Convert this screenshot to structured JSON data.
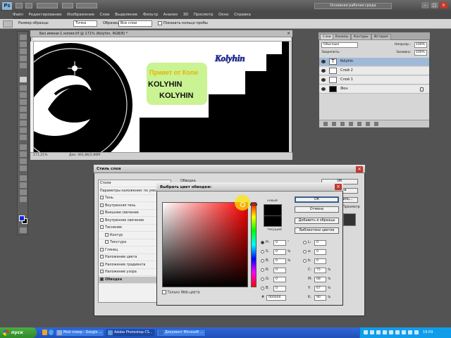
{
  "app": {
    "logo": "Ps",
    "workspace_button": "Основная рабочая среда",
    "menu": [
      "Файл",
      "Редактирование",
      "Изображение",
      "Слои",
      "Выделение",
      "Фильтр",
      "Анализ",
      "3D",
      "Просмотр",
      "Окно",
      "Справка"
    ],
    "window_controls": [
      "minimize-icon",
      "maximize-icon",
      "close-icon"
    ]
  },
  "options_bar": {
    "size_label": "Размер образца:",
    "size_value": "Точка",
    "sample_label": "Образец:",
    "sample_value": "Все слои",
    "show_ring_label": "Показать кольцо пробы"
  },
  "document": {
    "tab_title": "Без имени-1 копия.tif @ 171% (Kolyhin, RGB/8) *",
    "zoom": "171,21%",
    "info": "Док: 461,8K/2,86M",
    "canvas_text": {
      "green_line1": "Привет от Коли",
      "green_line2": "KOLYHIN",
      "green_line3": "KOLYHIN",
      "blue_logo": "Kolyhin"
    }
  },
  "layers_panel": {
    "tabs": [
      "Слои",
      "Каналы",
      "Контуры",
      "История"
    ],
    "blend_mode": "Обычные",
    "opacity_label": "Непрозр.:",
    "opacity_value": "100%",
    "fill_label": "Заливка:",
    "fill_value": "100%",
    "lock_label": "Закрепить:",
    "layers": [
      {
        "name": "Kolyhin",
        "type": "text",
        "selected": true
      },
      {
        "name": "Слой 2",
        "type": "pixel",
        "selected": false
      },
      {
        "name": "Слой 1",
        "type": "pixel",
        "selected": false
      },
      {
        "name": "Фон",
        "type": "background",
        "selected": false
      }
    ]
  },
  "layer_style_dialog": {
    "title": "Стиль слоя",
    "group_header": "Обводка",
    "items": [
      {
        "label": "Стили",
        "checkbox": false,
        "selected": false
      },
      {
        "label": "Параметры наложения: по умолчанию",
        "checkbox": false,
        "selected": false
      },
      {
        "label": "Тень",
        "checkbox": true,
        "selected": false
      },
      {
        "label": "Внутренняя тень",
        "checkbox": true,
        "selected": false
      },
      {
        "label": "Внешнее свечение",
        "checkbox": true,
        "selected": false
      },
      {
        "label": "Внутреннее свечение",
        "checkbox": true,
        "selected": false
      },
      {
        "label": "Тиснение",
        "checkbox": true,
        "selected": false
      },
      {
        "label": "Контур",
        "checkbox": true,
        "selected": false,
        "indent": true
      },
      {
        "label": "Текстура",
        "checkbox": true,
        "selected": false,
        "indent": true
      },
      {
        "label": "Глянец",
        "checkbox": true,
        "selected": false
      },
      {
        "label": "Наложение цвета",
        "checkbox": true,
        "selected": false
      },
      {
        "label": "Наложение градиента",
        "checkbox": true,
        "selected": false
      },
      {
        "label": "Наложение узора",
        "checkbox": true,
        "selected": false
      },
      {
        "label": "Обводка",
        "checkbox": true,
        "selected": true
      }
    ],
    "side_buttons": [
      "ОК",
      "Отмена",
      "Новый стиль..."
    ],
    "side_label": "Просмотр"
  },
  "color_picker": {
    "title": "Выбрать цвет обводки:",
    "new_label": "новый",
    "current_label": "текущий",
    "buttons": [
      "ОК",
      "Отмена",
      "Добавить в образцы",
      "Библиотеки цветов"
    ],
    "fields": {
      "H": "0",
      "S": "0",
      "B": "0",
      "R": "0",
      "G": "0",
      "Bl": "0",
      "L": "0",
      "a": "0",
      "b": "0",
      "C": "75",
      "M": "68",
      "Y": "67",
      "K": "90",
      "hex": "000000"
    },
    "units": {
      "degree": "°",
      "percent": "%"
    },
    "web_only_label": "Только Web-цвета",
    "sat_cursor_pct": {
      "saturation": 95,
      "brightness": 100
    },
    "hue_pct": 2
  },
  "taskbar": {
    "start_label": "пуск",
    "tasks": [
      {
        "label": "Мой плеер - Google ...",
        "active": false
      },
      {
        "label": "Adobe Photoshop CS...",
        "active": true
      },
      {
        "label": "Документ Microsoft ...",
        "active": false
      }
    ],
    "clock": "19:59"
  },
  "colors": {
    "foreground": "#0a2dd8",
    "background": "#000000",
    "ps_accent": "#8ab4d8"
  }
}
